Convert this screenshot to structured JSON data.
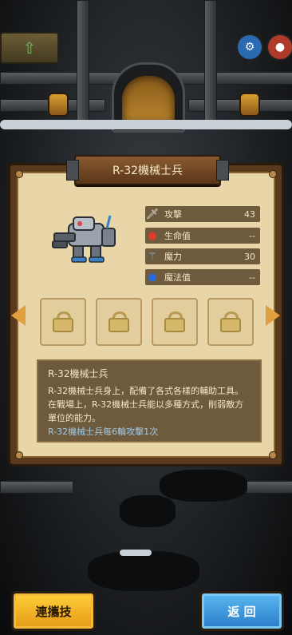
{
  "unit": {
    "name": "R-32機械士兵",
    "stats": [
      {
        "icon": "sword-icon",
        "label": "攻擊",
        "value": "43"
      },
      {
        "icon": "red-potion-icon",
        "label": "生命值",
        "value": "--"
      },
      {
        "icon": "magic-staff-icon",
        "label": "魔力",
        "value": "30"
      },
      {
        "icon": "blue-potion-icon",
        "label": "魔法值",
        "value": "--"
      }
    ],
    "skill_slots": [
      {
        "state": "locked"
      },
      {
        "state": "locked"
      },
      {
        "state": "locked"
      },
      {
        "state": "locked"
      }
    ],
    "description": {
      "title": "R-32機械士兵",
      "body": "R-32機械士兵身上，配備了各式各樣的輔助工具。在戰場上，R-32機械士兵能以多種方式，削弱敵方單位的能力。",
      "note": "R-32機械士兵每6輪攻擊1次"
    }
  },
  "buttons": {
    "combo_label": "連攜技",
    "back_label": "返 回"
  },
  "icons": {
    "hud_left": "up-arrow-icon",
    "hud_round_1": "settings-icon",
    "hud_round_2": "shop-icon",
    "prev": "left-arrow-icon",
    "next": "right-arrow-icon"
  },
  "colors": {
    "parchment": "#e8d5a8",
    "stat_row_bg": "#6e5a3c",
    "combo_button": "#f5b020",
    "back_button": "#3a98e0",
    "note_text": "#9ec8e8"
  }
}
